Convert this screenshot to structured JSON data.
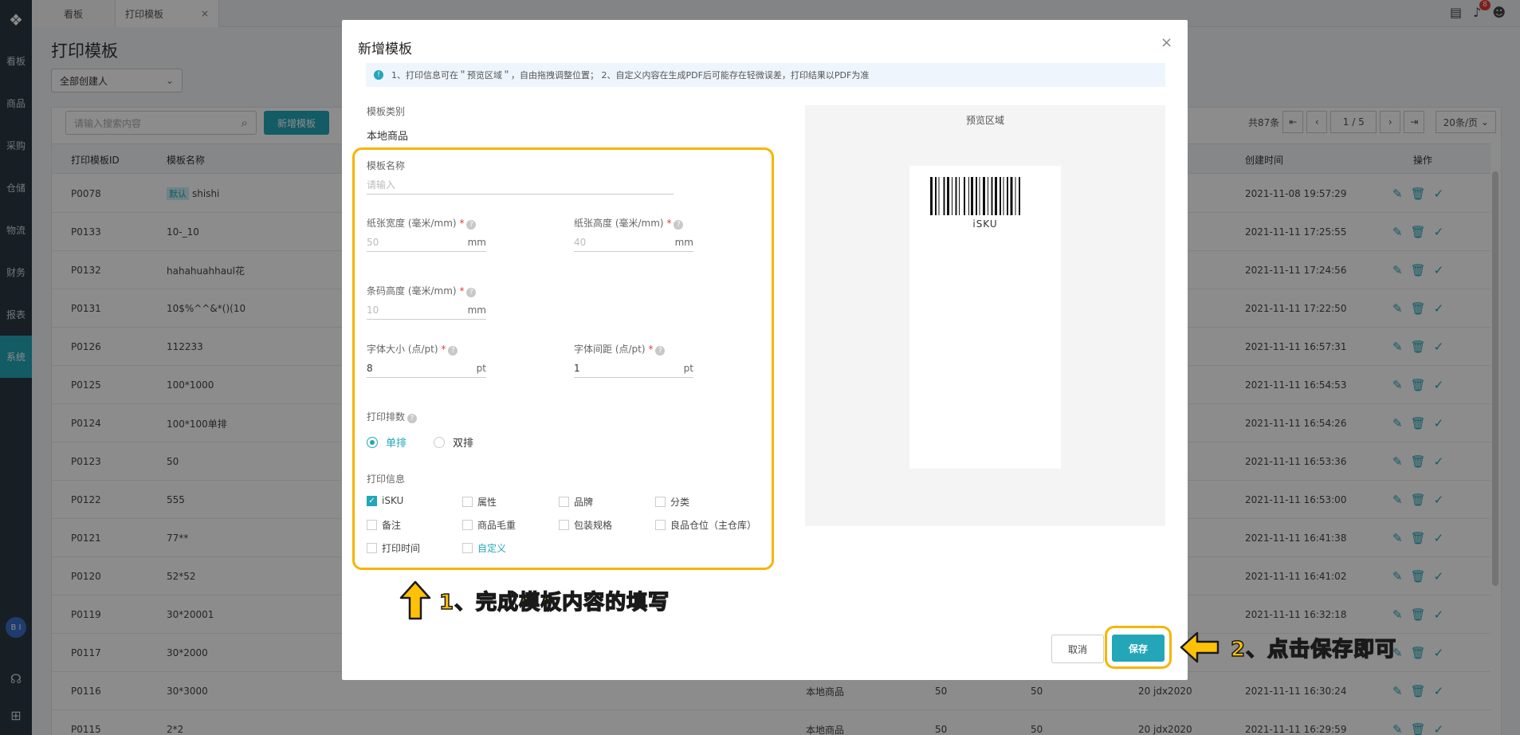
{
  "sidebar": {
    "items": [
      "看板",
      "商品",
      "采购",
      "仓储",
      "物流",
      "财务",
      "报表",
      "系统"
    ],
    "bi": "B I"
  },
  "tabs": [
    {
      "label": "看板"
    },
    {
      "label": "打印模板",
      "close": "×"
    }
  ],
  "header": {
    "badge_count": "8"
  },
  "page": {
    "title": "打印模板",
    "creator_filter": "全部创建人",
    "search_placeholder": "请输入搜索内容",
    "add_button": "新增模板"
  },
  "pagination": {
    "total": "共87条",
    "current": "1",
    "separator": "/ 5",
    "page_size": "20条/页"
  },
  "table": {
    "headers": {
      "id": "打印模板ID",
      "name": "模板名称",
      "created": "创建时间",
      "ops": "操作"
    },
    "default_tag": "默认",
    "rows": [
      {
        "id": "P0078",
        "name": "shishi",
        "tag": true,
        "category": "",
        "w": "",
        "h": "",
        "n": "",
        "creator": "",
        "created": "2021-11-08 19:57:29"
      },
      {
        "id": "P0133",
        "name": "10-_10",
        "category": "",
        "w": "",
        "h": "",
        "n": "",
        "creator": "",
        "created": "2021-11-11 17:25:55"
      },
      {
        "id": "P0132",
        "name": "hahahuahhaul花",
        "category": "",
        "w": "",
        "h": "",
        "n": "",
        "creator": "",
        "created": "2021-11-11 17:24:56"
      },
      {
        "id": "P0131",
        "name": "10$%^^&*()(10",
        "category": "",
        "w": "",
        "h": "",
        "n": "",
        "creator": "",
        "created": "2021-11-11 17:22:50"
      },
      {
        "id": "P0126",
        "name": "112233",
        "category": "",
        "w": "",
        "h": "",
        "n": "",
        "creator": "",
        "created": "2021-11-11 16:57:31"
      },
      {
        "id": "P0125",
        "name": "100*1000",
        "category": "",
        "w": "",
        "h": "",
        "n": "",
        "creator": "",
        "created": "2021-11-11 16:54:53"
      },
      {
        "id": "P0124",
        "name": "100*100单排",
        "category": "",
        "w": "",
        "h": "",
        "n": "",
        "creator": "",
        "created": "2021-11-11 16:54:26"
      },
      {
        "id": "P0123",
        "name": "50",
        "category": "",
        "w": "",
        "h": "",
        "n": "",
        "creator": "",
        "created": "2021-11-11 16:53:36"
      },
      {
        "id": "P0122",
        "name": "555",
        "category": "",
        "w": "",
        "h": "",
        "n": "",
        "creator": "",
        "created": "2021-11-11 16:53:00"
      },
      {
        "id": "P0121",
        "name": "77**",
        "category": "",
        "w": "",
        "h": "",
        "n": "",
        "creator": "",
        "created": "2021-11-11 16:41:38"
      },
      {
        "id": "P0120",
        "name": "52*52",
        "category": "",
        "w": "",
        "h": "",
        "n": "",
        "creator": "",
        "created": "2021-11-11 16:41:02"
      },
      {
        "id": "P0119",
        "name": "30*20001",
        "category": "",
        "w": "",
        "h": "",
        "n": "",
        "creator": "",
        "created": "2021-11-11 16:32:18"
      },
      {
        "id": "P0117",
        "name": "30*2000",
        "category": "",
        "w": "",
        "h": "",
        "n": "",
        "creator": "",
        "created": ""
      },
      {
        "id": "P0116",
        "name": "30*3000",
        "category": "本地商品",
        "w": "50",
        "h": "50",
        "n": "20",
        "creator": "jdx2020",
        "created": "2021-11-11 16:30:24"
      },
      {
        "id": "P0115",
        "name": "2*2",
        "category": "本地商品",
        "w": "50",
        "h": "50",
        "n": "20",
        "creator": "jdx2020",
        "created": "2021-11-11 16:29:59"
      }
    ]
  },
  "modal": {
    "title": "新增模板",
    "close": "×",
    "notice": "1、打印信息可在＂预览区域＂，自由拖拽调整位置； 2、自定义内容在生成PDF后可能存在轻微误差，打印结果以PDF为准",
    "category_label": "模板类别",
    "category_value": "本地商品",
    "name_label": "模板名称",
    "name_placeholder": "请输入",
    "paper_width_label": "纸张宽度 (毫米/mm)",
    "paper_width_value": "50",
    "paper_height_label": "纸张高度 (毫米/mm)",
    "paper_height_value": "40",
    "barcode_height_label": "条码高度 (毫米/mm)",
    "barcode_height_value": "10",
    "font_size_label": "字体大小 (点/pt)",
    "font_size_value": "8",
    "letter_spacing_label": "字体间距 (点/pt)",
    "letter_spacing_value": "1",
    "unit_mm": "mm",
    "unit_pt": "pt",
    "required_mark": "*",
    "help": "?",
    "rows_label": "打印排数",
    "rows_single": "单排",
    "rows_double": "双排",
    "info_label": "打印信息",
    "info_options": [
      {
        "label": "iSKU",
        "checked": true
      },
      {
        "label": "属性",
        "checked": false
      },
      {
        "label": "品牌",
        "checked": false
      },
      {
        "label": "分类",
        "checked": false
      },
      {
        "label": "备注",
        "checked": false
      },
      {
        "label": "商品毛重",
        "checked": false
      },
      {
        "label": "包装规格",
        "checked": false
      },
      {
        "label": "良品仓位（主仓库）",
        "checked": false
      },
      {
        "label": "打印时间",
        "checked": false
      },
      {
        "label": "自定义",
        "checked": false,
        "link": true
      }
    ],
    "preview_title": "预览区域",
    "preview_text": "iSKU",
    "cancel": "取消",
    "save": "保存"
  },
  "annotations": {
    "step1": "1、完成模板内容的填写",
    "step2": "2、点击保存即可"
  },
  "colors": {
    "accent": "#23a6b8",
    "highlight": "#f7b500",
    "sidebar": "#2b3a44"
  }
}
